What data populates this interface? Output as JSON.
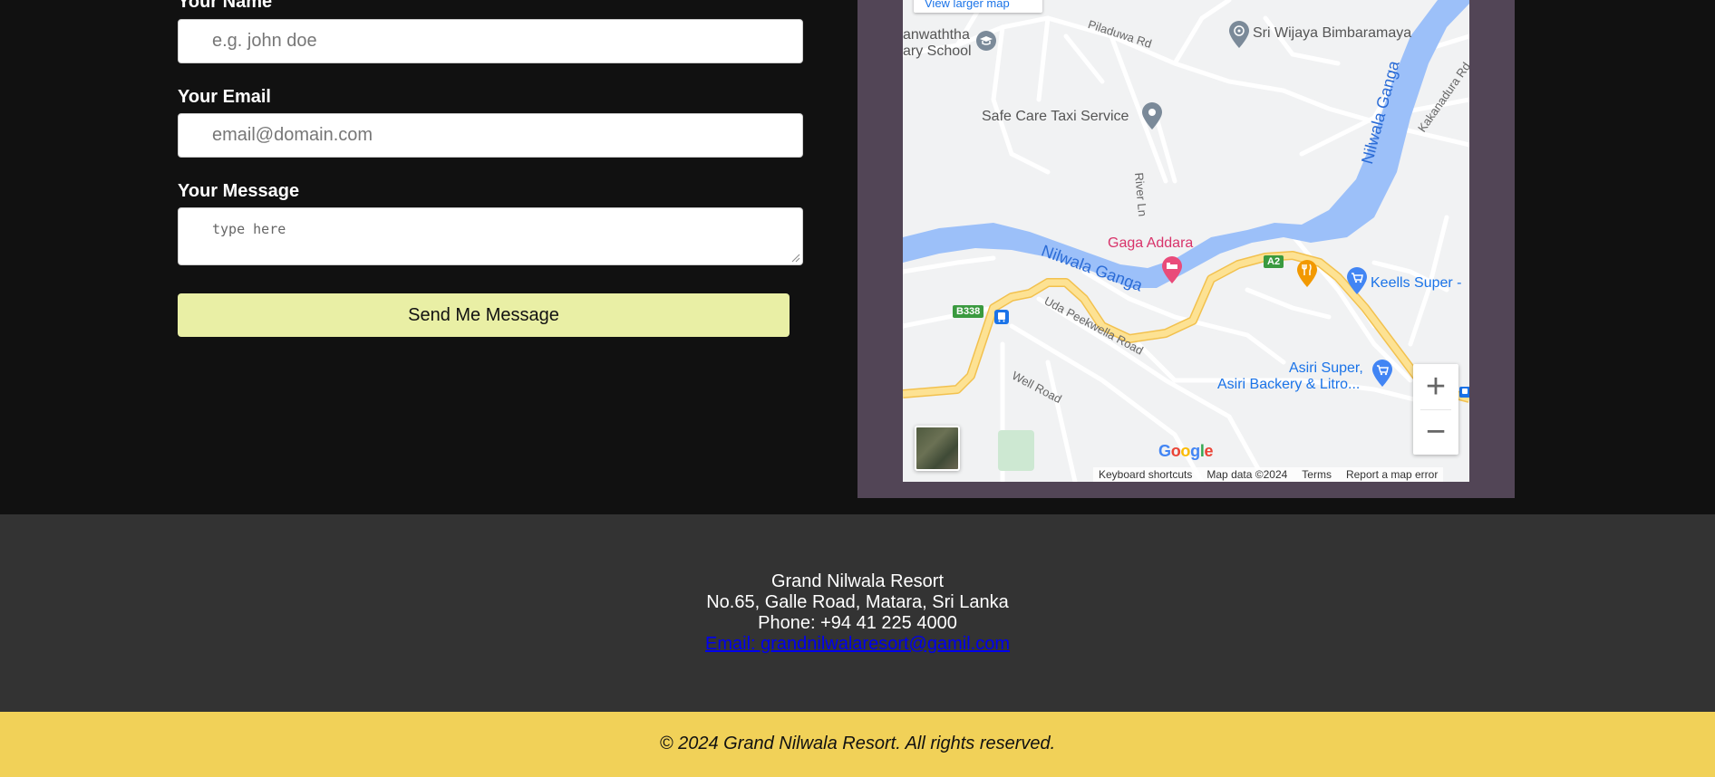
{
  "form": {
    "name_label": "Your Name",
    "name_placeholder": "e.g. john doe",
    "email_label": "Your Email",
    "email_placeholder": "email@domain.com",
    "message_label": "Your Message",
    "message_placeholder": "type here",
    "send_label": "Send Me Message"
  },
  "map": {
    "larger_map_link": "View larger map",
    "places": {
      "school": "anwaththa\nary School",
      "temple": "Sri Wijaya Bimbaramaya",
      "taxi": "Safe Care Taxi Service",
      "hotel": "Gaga Addara",
      "supermarket_keells": "Keells Super -",
      "supermarket_asiri_1": "Asiri Super,",
      "supermarket_asiri_2": "Asiri Backery & Litro..."
    },
    "roads": {
      "piladuwa": "Piladuwa Rd",
      "river_ln": "River Ln",
      "kakanadura": "Kakanadura Rd",
      "uda_peekwella": "Uda Peekwella Road",
      "well_road": "Well Road",
      "b338": "B338",
      "a2": "A2"
    },
    "rivers": {
      "nilwala_upper": "Nilwala Ganga",
      "nilwala_lower": "Nilwala Ganga"
    },
    "zoom_in": "+",
    "zoom_out": "−",
    "google_logo": "Google",
    "attribution": {
      "shortcuts": "Keyboard shortcuts",
      "data": "Map data ©2024",
      "terms": "Terms",
      "report": "Report a map error"
    },
    "colors": {
      "water": "#9cc0f9",
      "road_major": "#fdd78a",
      "road_minor": "#ffffff",
      "land": "#f1f2f3",
      "pin_red": "#e94b7a",
      "pin_blue": "#4285f4",
      "pin_orange": "#f29900",
      "pin_gray": "#7b8a99"
    }
  },
  "footer": {
    "name": "Grand Nilwala Resort",
    "address": "No.65, Galle Road, Matara, Sri Lanka",
    "phone": "Phone: +94 41 225 4000",
    "email": "Email: grandnilwalaresort@gamil.com",
    "copyright": "© 2024 Grand Nilwala Resort. All rights reserved."
  }
}
